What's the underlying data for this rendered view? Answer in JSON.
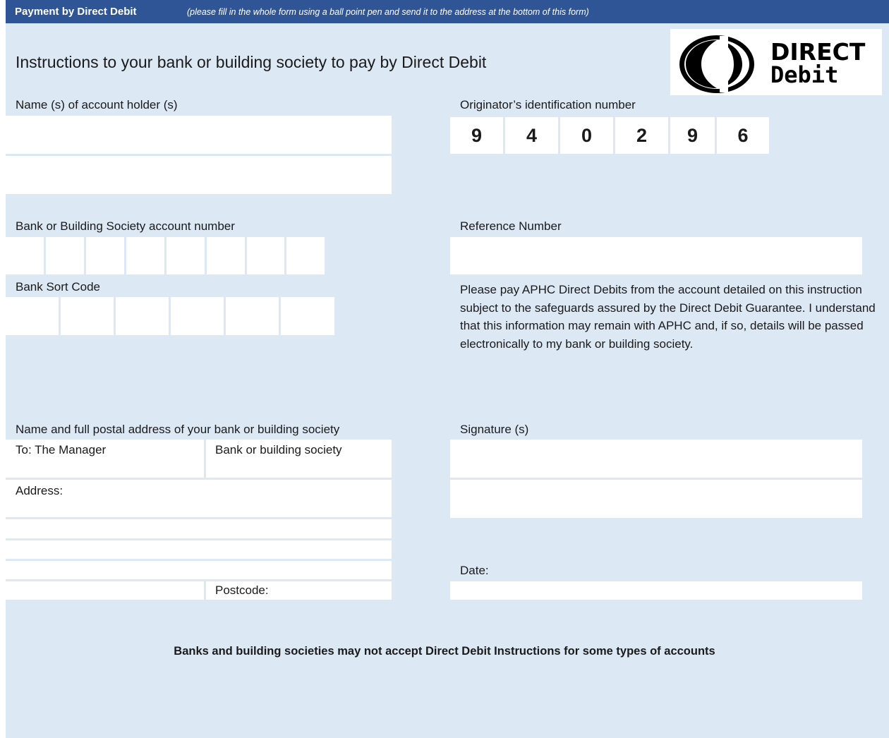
{
  "header": {
    "title": "Payment by Direct Debit",
    "note": "(please fill in the whole form using a ball point pen and send it to the address at the bottom of this form)"
  },
  "form_title": "Instructions to your bank or building society to pay by Direct Debit",
  "logo": {
    "line1": "DIRECT",
    "line2": "Debit"
  },
  "labels": {
    "account_holder": "Name (s) of account holder (s)",
    "originator_id": "Originator’s identification number",
    "account_number": "Bank or Building Society account number",
    "reference_number": "Reference Number",
    "sort_code": "Bank Sort Code",
    "bank_address": "Name and full postal address of your bank or building society",
    "signature": "Signature (s)",
    "to_manager": "To: The Manager",
    "bank_or_society": "Bank or building society",
    "address": "Address:",
    "postcode": "Postcode:",
    "date": "Date:"
  },
  "originator_digits": [
    "9",
    "4",
    "0",
    "2",
    "9",
    "6"
  ],
  "instruction_text": "Please pay APHC Direct Debits from the account detailed on this instruction subject to the safeguards assured by the Direct Debit Guarantee. I understand that this information may remain with APHC and, if so, details will be passed electronically to my bank or building society.",
  "footer_note": "Banks and building societies may not accept Direct Debit Instructions for some types of accounts",
  "colors": {
    "header": "#2f5597",
    "background": "#dde8f5",
    "field": "#ffffff"
  }
}
